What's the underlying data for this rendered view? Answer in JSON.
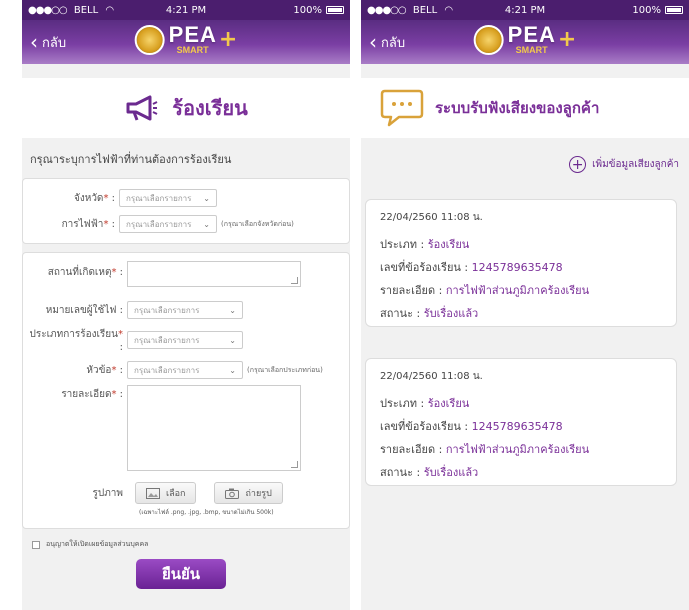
{
  "status_bar": {
    "carrier": "BELL",
    "time": "4:21 PM",
    "battery": "100%"
  },
  "nav": {
    "back_label": "กลับ",
    "logo_text": "PEA",
    "logo_sub": "SMART",
    "logo_plus": "+"
  },
  "complaint_form": {
    "title": "ร้องเรียน",
    "intro": "กรุณาระบุการไฟฟ้าที่ท่านต้องการร้องเรียน",
    "province_label": "จังหวัด",
    "province_placeholder": "กรุณาเลือกรายการ",
    "office_label": "การไฟฟ้า",
    "office_placeholder": "กรุณาเลือกรายการ",
    "office_hint": "(กรุณาเลือกจังหวัดก่อน)",
    "location_label": "สถานที่เกิดเหตุ",
    "meter_label": "หมายเลขผู้ใช้ไฟ",
    "meter_placeholder": "กรุณาเลือกรายการ",
    "type_label": "ประเภทการร้องเรียน",
    "type_placeholder": "กรุณาเลือกรายการ",
    "topic_label": "หัวข้อ",
    "topic_placeholder": "กรุณาเลือกรายการ",
    "topic_hint": "(กรุณาเลือกประเภทก่อน)",
    "detail_label": "รายละเอียด",
    "photo_label": "รูปภาพ",
    "choose_button": "เลือก",
    "camera_button": "ถ่ายรูป",
    "file_note": "(เฉพาะไฟล์ .png, .jpg, .bmp, ขนาดไม่เกิน 500k)",
    "consent_text": "อนุญาตให้เปิดเผยข้อมูลส่วนบุคคล",
    "submit_label": "ยืนยัน",
    "required_mark": "*",
    "colon": ":"
  },
  "feedback_list": {
    "title": "ระบบรับฟังเสียงของลูกค้า",
    "add_label": "เพิ่มข้อมูลเสียงลูกค้า",
    "entries": [
      {
        "datetime": "22/04/2560  11:08 น.",
        "type_label": "ประเภท : ",
        "type_value": "ร้องเรียน",
        "id_label": "เลขที่ข้อร้องเรียน : ",
        "id_value": "1245789635478",
        "detail_label": "รายละเอียด : ",
        "detail_value": "การไฟฟ้าส่วนภูมิภาคร้องเรียน",
        "status_label": "สถานะ : ",
        "status_value": "รับเรื่องแล้ว"
      },
      {
        "datetime": "22/04/2560  11:08 น.",
        "type_label": "ประเภท : ",
        "type_value": "ร้องเรียน",
        "id_label": "เลขที่ข้อร้องเรียน : ",
        "id_value": "1245789635478",
        "detail_label": "รายละเอียด : ",
        "detail_value": "การไฟฟ้าส่วนภูมิภาคร้องเรียน",
        "status_label": "สถานะ : ",
        "status_value": "รับเรื่องแล้ว"
      }
    ]
  },
  "colors": {
    "brand_purple": "#7a2f98",
    "nav_dark": "#4b1e6e"
  }
}
